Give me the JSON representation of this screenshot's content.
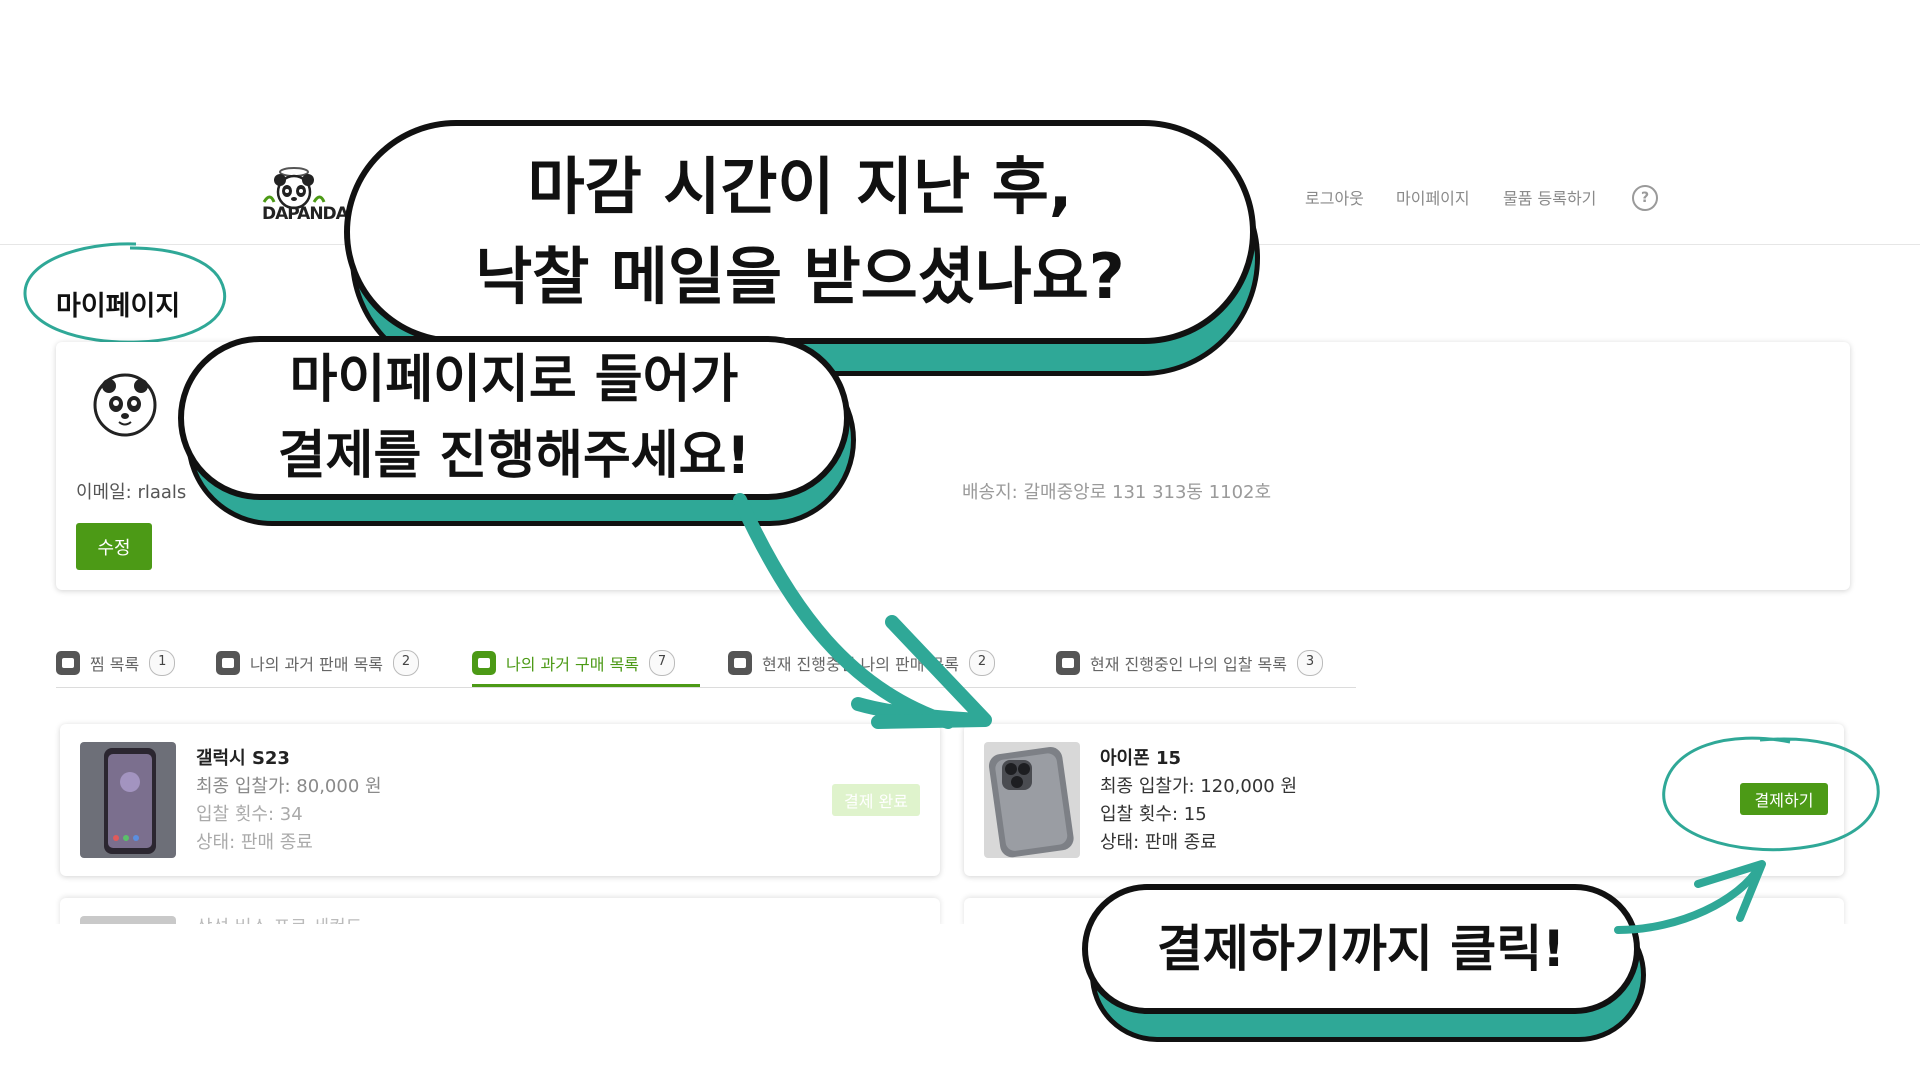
{
  "header": {
    "logo_text": "DAPANDA",
    "nav": [
      "로그아웃",
      "마이페이지",
      "물품 등록하기"
    ],
    "help_glyph": "?"
  },
  "page_title": "마이페이지",
  "profile": {
    "email": "이메일: rlaals",
    "address": "배송지: 갈매중앙로 131 313동 1102호",
    "edit_label": "수정"
  },
  "tabs": [
    {
      "icon": "image-icon",
      "label": "찜 목록",
      "count": "1"
    },
    {
      "icon": "music-icon",
      "label": "나의 과거 판매 목록",
      "count": "2"
    },
    {
      "icon": "calendar-icon",
      "label": "나의 과거 구매 목록",
      "count": "7",
      "active": true
    },
    {
      "icon": "calendar-icon",
      "label": "현재 진행중인 나의 판매 목록",
      "count": "2"
    },
    {
      "icon": "calendar-icon",
      "label": "현재 진행중인 나의 입찰 목록",
      "count": "3"
    }
  ],
  "items": [
    {
      "name": "갤럭시 S23",
      "price": "최종 입찰가: 80,000 원",
      "bids": "입찰 횟수: 34",
      "status": "상태: 판매 종료",
      "button": "결제 완료",
      "faded": true
    },
    {
      "name": "아이폰 15",
      "price": "최종 입찰가: 120,000 원",
      "bids": "입찰 횟수: 15",
      "status": "상태: 판매 종료",
      "button": "결제하기",
      "faded": false
    }
  ],
  "partial_item_name": "삼성 버스 프로 세컨드",
  "annotations": {
    "bubble1": [
      "마감 시간이 지난 후,",
      "낙찰 메일을 받으셨나요?"
    ],
    "bubble2": [
      "마이페이지로 들어가",
      "결제를 진행해주세요!"
    ],
    "bubble3": [
      "결제하기까지 클릭!"
    ]
  },
  "colors": {
    "brand_green": "#4c9a16",
    "annotation_teal": "#2fa897",
    "faded_button": "#dff3cc"
  }
}
